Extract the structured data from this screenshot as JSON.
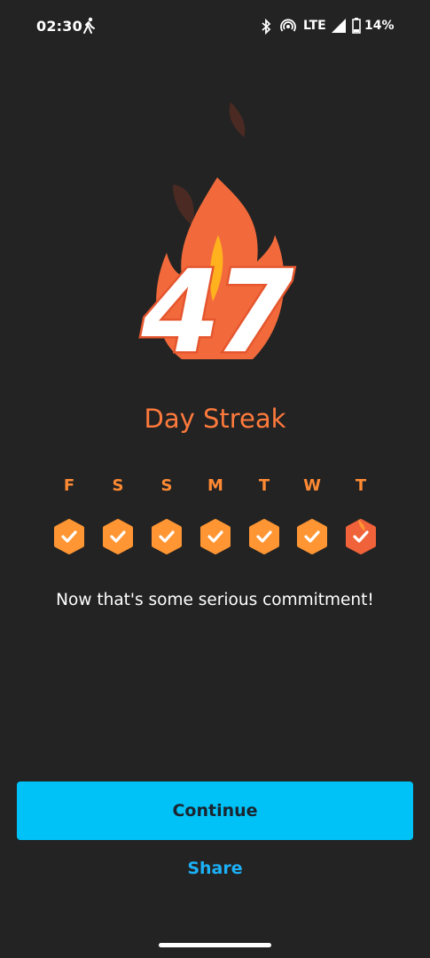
{
  "status_bar": {
    "time": "02:30",
    "network": "LTE",
    "battery": "14%",
    "icons": [
      "walk-icon",
      "bluetooth-icon",
      "hotspot-icon",
      "signal-icon",
      "battery-icon"
    ]
  },
  "streak": {
    "number": "47",
    "label": "Day Streak"
  },
  "week": [
    {
      "day": "F",
      "state": "done"
    },
    {
      "day": "S",
      "state": "done"
    },
    {
      "day": "S",
      "state": "done"
    },
    {
      "day": "M",
      "state": "done"
    },
    {
      "day": "T",
      "state": "done"
    },
    {
      "day": "W",
      "state": "done"
    },
    {
      "day": "T",
      "state": "today"
    }
  ],
  "message": "Now that's some serious commitment!",
  "actions": {
    "continue_label": "Continue",
    "share_label": "Share"
  },
  "colors": {
    "background": "#232323",
    "accent_orange": "#ff7a3c",
    "badge_orange": "#ff9633",
    "today_badge": "#f0623a",
    "button_blue": "#00c2f6",
    "link_blue": "#1cb0f6"
  }
}
